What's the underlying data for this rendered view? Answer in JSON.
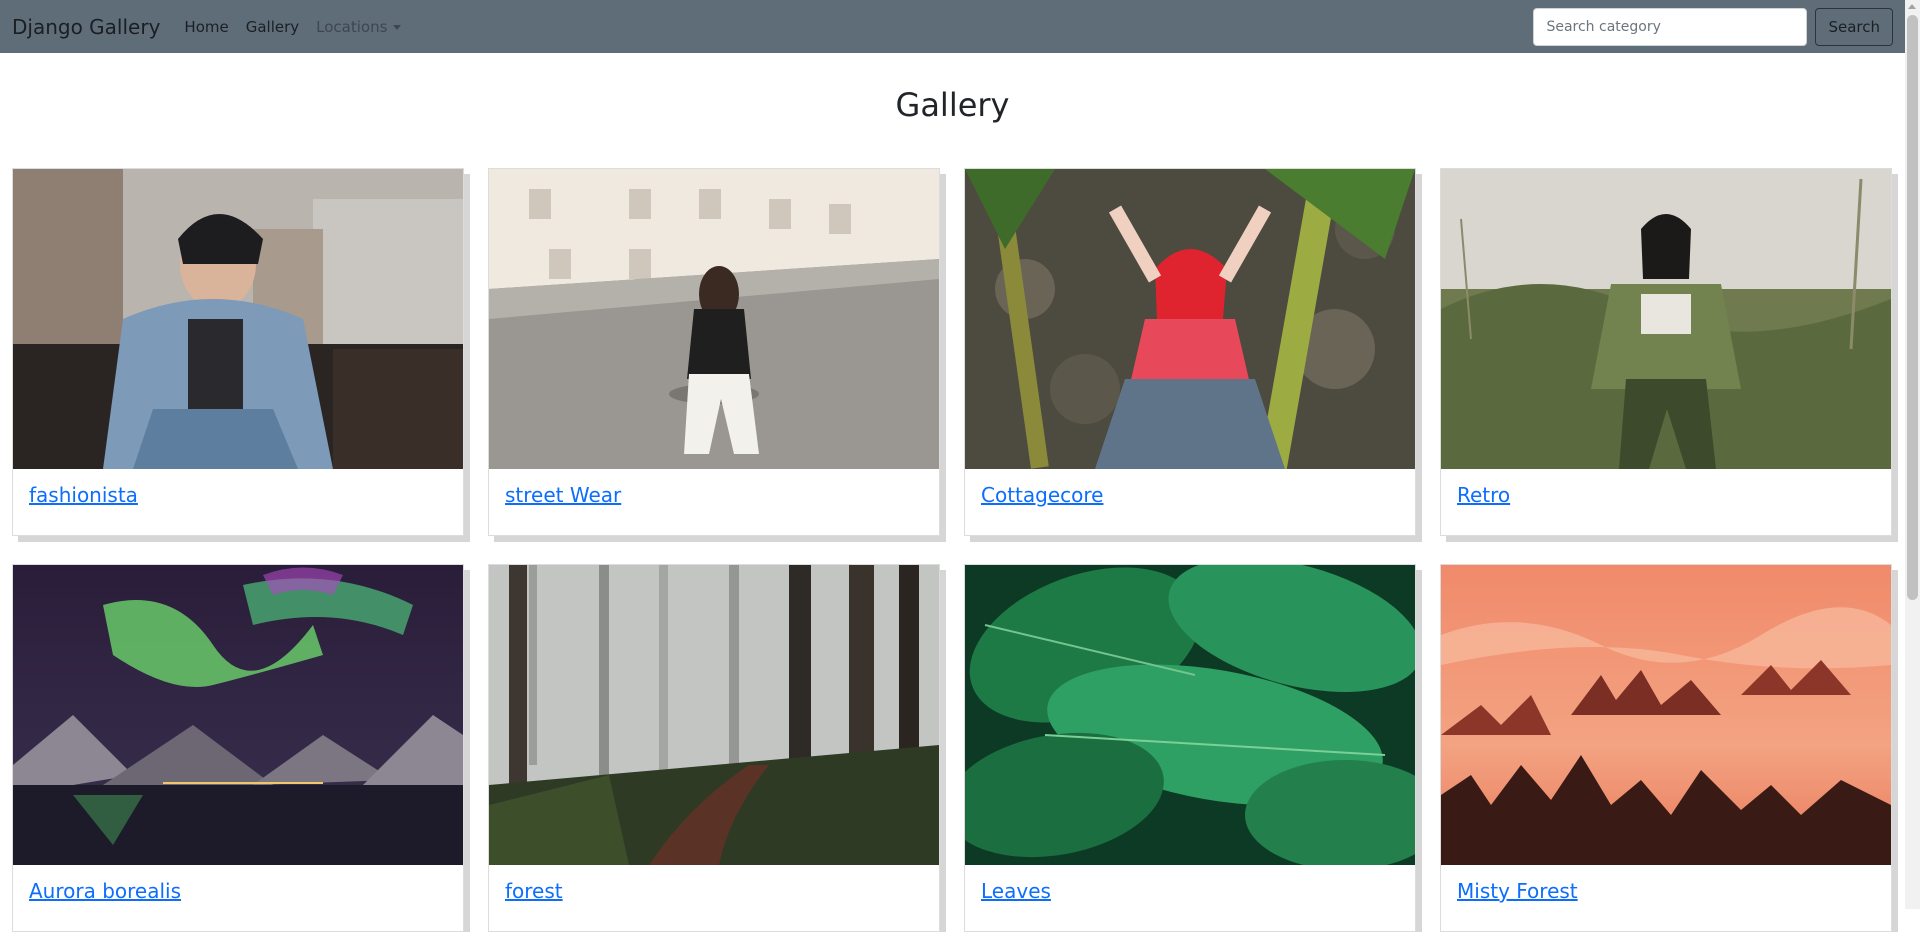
{
  "navbar": {
    "brand": "Django Gallery",
    "links": [
      "Home",
      "Gallery"
    ],
    "dropdown_label": "Locations",
    "search_placeholder": "Search category",
    "search_button": "Search",
    "bg_color": "#5f6d78"
  },
  "page": {
    "title": "Gallery"
  },
  "cards": [
    {
      "label": "fashionista",
      "image": "man-in-denim-jacket-photo"
    },
    {
      "label": "street Wear",
      "image": "woman-walking-on-street-photo"
    },
    {
      "label": "Cottagecore",
      "image": "woman-in-gingham-dress-photo"
    },
    {
      "label": "Retro",
      "image": "woman-in-green-jacket-field-photo"
    },
    {
      "label": "Aurora borealis",
      "image": "northern-lights-over-lake-photo"
    },
    {
      "label": "forest",
      "image": "misty-pine-forest-path-photo"
    },
    {
      "label": "Leaves",
      "image": "green-hosta-leaves-photo"
    },
    {
      "label": "Misty Forest",
      "image": "orange-foggy-forest-photo"
    }
  ],
  "colors": {
    "link": "#0d6efd"
  }
}
